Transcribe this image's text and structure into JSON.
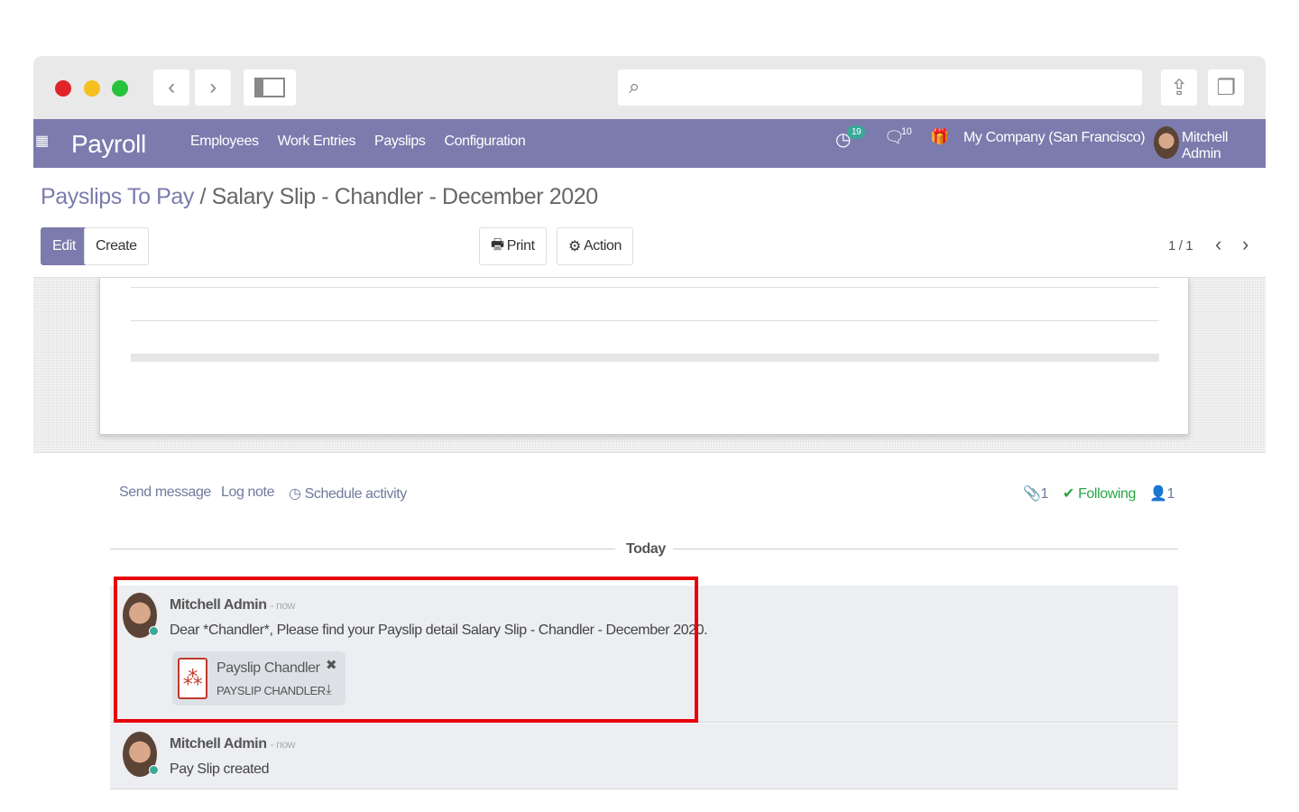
{
  "browser": {
    "colors": {
      "close": "#e0242a",
      "min": "#f5bf1e",
      "max": "#27c23c"
    }
  },
  "navbar": {
    "app": "Payroll",
    "menu": [
      "Employees",
      "Work Entries",
      "Payslips",
      "Configuration"
    ],
    "activity_count": "19",
    "message_count": "10",
    "company": "My Company (San Francisco)",
    "user": "Mitchell Admin",
    "color": "#7c7bad"
  },
  "breadcrumb": {
    "parent": "Payslips To Pay",
    "separator": " / ",
    "current": "Salary Slip - Chandler - December 2020"
  },
  "buttons": {
    "edit": "Edit",
    "create": "Create",
    "print": "Print",
    "action": "Action"
  },
  "pager": {
    "value": "1 / 1"
  },
  "chatter": {
    "send_message": "Send message",
    "log_note": "Log note",
    "schedule_activity": "Schedule activity",
    "attachments": "1",
    "following": "Following",
    "followers": "1",
    "date_separator": "Today",
    "messages": [
      {
        "author": "Mitchell Admin",
        "time": "- now",
        "body": "Dear *Chandler*, Please find your Payslip detail Salary Slip - Chandler - December 2020.",
        "attachment": {
          "name": "Payslip Chandler",
          "type": "PAYSLIP CHANDLER"
        }
      },
      {
        "author": "Mitchell Admin",
        "time": "- now",
        "body": "Pay Slip created"
      }
    ]
  }
}
